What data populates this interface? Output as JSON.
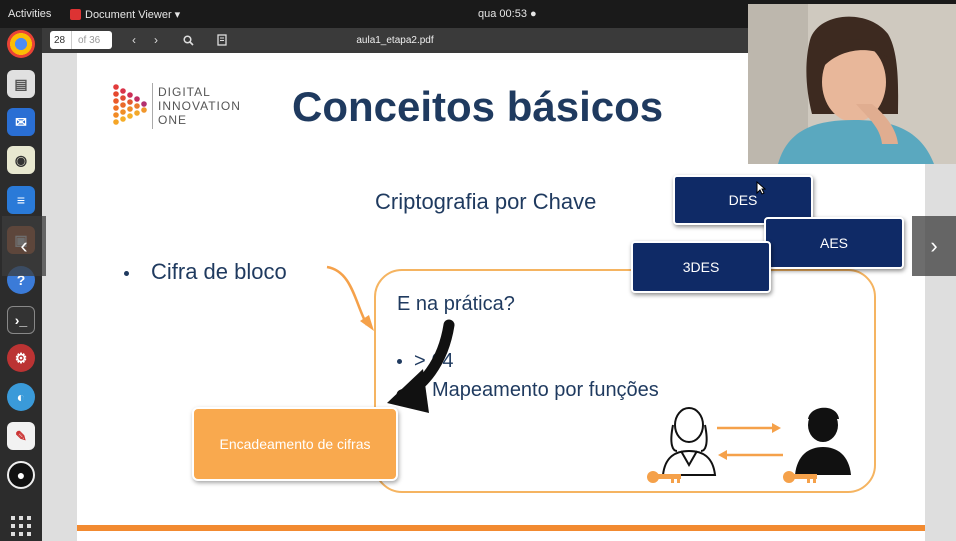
{
  "topbar": {
    "activities": "Activities",
    "app_name": "Document Viewer ▾",
    "clock": "qua 00:53 ●"
  },
  "viewer": {
    "page_current": "28",
    "page_total": "of 36",
    "filename": "aula1_etapa2.pdf"
  },
  "slide": {
    "logo_lines": [
      "DIGITAL",
      "INNOVATION",
      "ONE"
    ],
    "title": "Conceitos básicos",
    "subtitle": "Criptografia por Chave",
    "bullet_main": "Cifra de bloco",
    "question": "E na prática?",
    "item_1": "> 64",
    "item_2": "Mapeamento por funções",
    "btn_des": "DES",
    "btn_aes": "AES",
    "btn_3des": "3DES",
    "orange_label": "Encadeamento de cifras"
  },
  "colors": {
    "title_navy": "#1f3a5f",
    "button_navy": "#0f2a66",
    "orange": "#f9a94e",
    "orange_line": "#f28a30"
  }
}
